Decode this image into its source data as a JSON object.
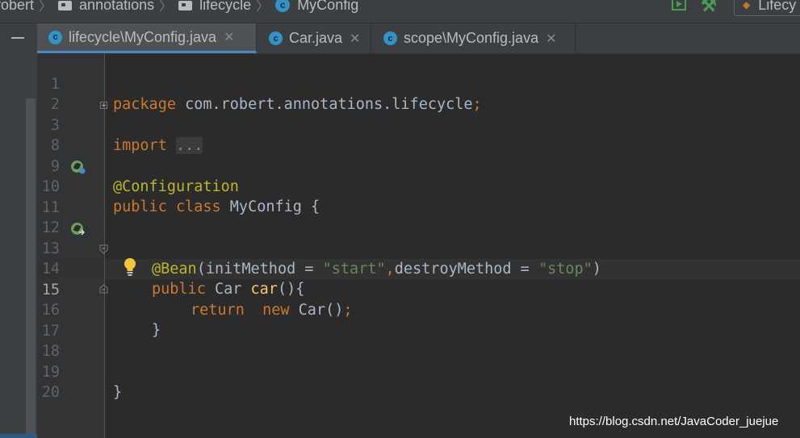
{
  "breadcrumbs": [
    {
      "label": "robert",
      "icon": "none"
    },
    {
      "label": "annotations",
      "icon": "package-icon"
    },
    {
      "label": "lifecycle",
      "icon": "package-icon"
    },
    {
      "label": "MyConfig",
      "icon": "class-icon"
    }
  ],
  "class_icon_letter": "c",
  "run_config": {
    "label": "Lifecy"
  },
  "tabs": [
    {
      "label": "lifecycle\\MyConfig.java",
      "active": true,
      "close": "✕"
    },
    {
      "label": "Car.java",
      "active": false,
      "close": "✕"
    },
    {
      "label": "scope\\MyConfig.java",
      "active": false,
      "close": "✕"
    }
  ],
  "editor": {
    "current_line": 15,
    "lines": [
      {
        "n": "1"
      },
      {
        "n": "2"
      },
      {
        "n": "3"
      },
      {
        "n": "8"
      },
      {
        "n": "9"
      },
      {
        "n": "10"
      },
      {
        "n": "11"
      },
      {
        "n": "12"
      },
      {
        "n": "13"
      },
      {
        "n": "14"
      },
      {
        "n": "15"
      },
      {
        "n": "16"
      },
      {
        "n": "17"
      },
      {
        "n": "18"
      },
      {
        "n": "19"
      },
      {
        "n": "20"
      }
    ],
    "code": {
      "l1_kw": "package",
      "l1_pkg": " com.robert.annotations.lifecycle",
      "l1_semi": ";",
      "l3_kw": "import",
      "l3_fold": "...",
      "l9_ann": "@Configuration",
      "l10_kw": "public class",
      "l10_rest": " MyConfig {",
      "l13_ann": "@Bean",
      "l13_p1": "(initMethod = ",
      "l13_s1": "\"start\"",
      "l13_comma": ",",
      "l13_p2": "destroyMethod = ",
      "l13_s2": "\"stop\"",
      "l13_close": ")",
      "l14_kw": "public",
      "l14_type": " Car ",
      "l14_fn": "car",
      "l14_rest": "(){",
      "l15_kw1": "return",
      "l15_sp": "  ",
      "l15_kw2": "new",
      "l15_rest": " Car()",
      "l15_semi": ";",
      "l16": "}",
      "l19": "}"
    }
  },
  "watermark": "https://blog.csdn.net/JavaCoder_juejue"
}
